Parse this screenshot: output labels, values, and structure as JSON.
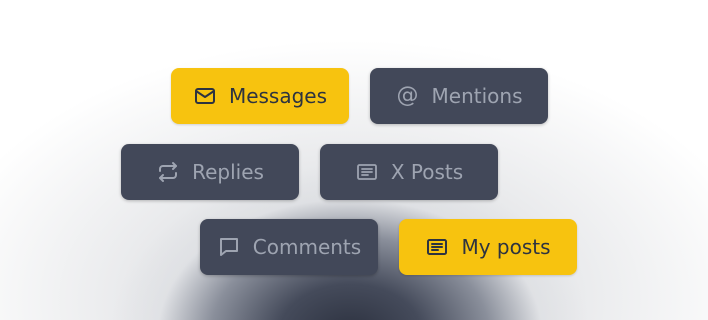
{
  "filters": {
    "messages": "Messages",
    "mentions": "Mentions",
    "mentions_glyph": "@",
    "replies": "Replies",
    "x_posts": "X Posts",
    "comments": "Comments",
    "my_posts": "My posts"
  },
  "icons": {
    "messages": "mail-icon",
    "mentions": "at-icon",
    "replies": "repeat-icon",
    "x_posts": "post-icon",
    "comments": "comment-icon",
    "my_posts": "post-icon"
  },
  "selected": [
    "messages",
    "my_posts"
  ],
  "colors": {
    "active_bg": "#f7c30f",
    "active_text": "#2d3340",
    "inactive_bg": "#424859",
    "inactive_text": "#9ea4b1"
  }
}
